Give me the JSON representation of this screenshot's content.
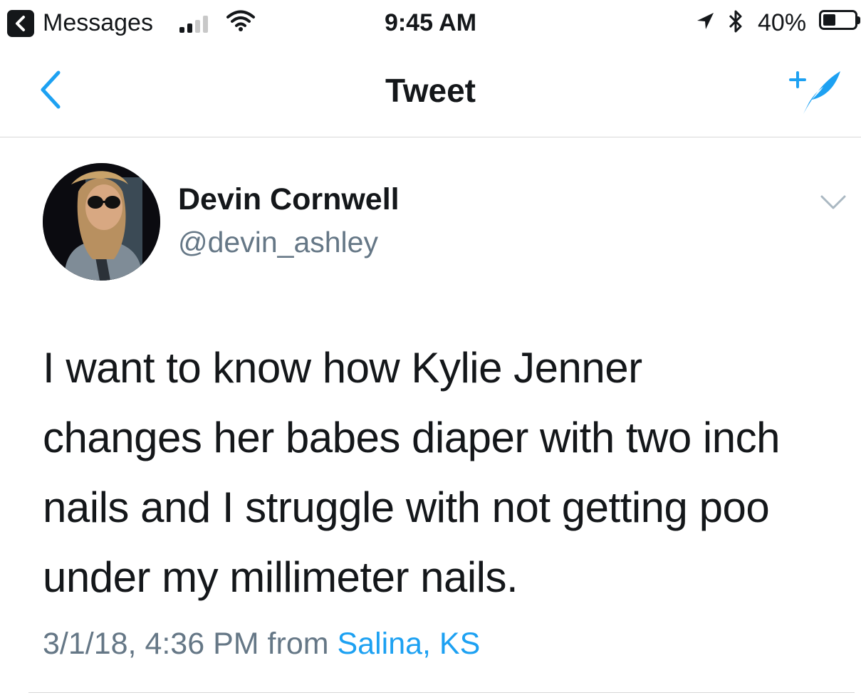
{
  "status_bar": {
    "back_app_label": "Messages",
    "time": "9:45 AM",
    "battery_percent": "40%",
    "battery_level": 0.4,
    "signal_bars_filled": 2,
    "signal_bars_total": 4
  },
  "nav": {
    "title": "Tweet",
    "back_icon": "chevron-left-icon",
    "compose_icon": "compose-tweet-icon"
  },
  "tweet": {
    "author_name": "Devin Cornwell",
    "author_handle": "@devin_ashley",
    "text_lines": [
      "I want to know how Kylie Jenner",
      "changes her babes diaper with two inch",
      "nails and I struggle with not getting poo",
      "under my millimeter nails."
    ],
    "timestamp": "3/1/18, 4:36 PM",
    "from_label": "from",
    "location": "Salina, KS"
  },
  "colors": {
    "accent": "#1da1f2",
    "text": "#14171a",
    "secondary_text": "#657786",
    "divider": "#d8d8d8"
  }
}
